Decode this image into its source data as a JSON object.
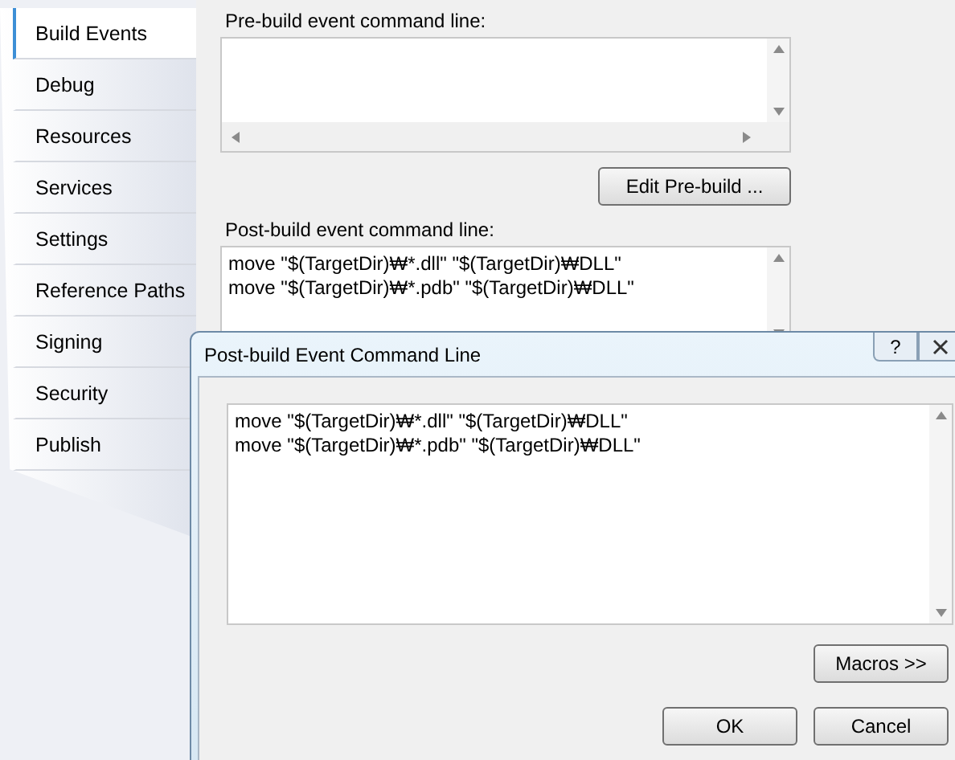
{
  "sidebar": {
    "items": [
      {
        "label": "Build Events",
        "selected": true
      },
      {
        "label": "Debug",
        "selected": false
      },
      {
        "label": "Resources",
        "selected": false
      },
      {
        "label": "Services",
        "selected": false
      },
      {
        "label": "Settings",
        "selected": false
      },
      {
        "label": "Reference Paths",
        "selected": false
      },
      {
        "label": "Signing",
        "selected": false
      },
      {
        "label": "Security",
        "selected": false
      },
      {
        "label": "Publish",
        "selected": false
      }
    ]
  },
  "pre_build": {
    "label": "Pre-build event command line:",
    "button": "Edit Pre-build ..."
  },
  "post_build": {
    "label": "Post-build event command line:",
    "lines": [
      "move \"$(TargetDir)₩*.dll\" \"$(TargetDir)₩DLL\"",
      "move \"$(TargetDir)₩*.pdb\" \"$(TargetDir)₩DLL\""
    ]
  },
  "dialog": {
    "title": "Post-build Event Command Line",
    "help": "?",
    "lines": [
      "move \"$(TargetDir)₩*.dll\" \"$(TargetDir)₩DLL\"",
      "move \"$(TargetDir)₩*.pdb\" \"$(TargetDir)₩DLL\""
    ],
    "macros_button": "Macros >>",
    "buttons": [
      "OK",
      "Cancel"
    ]
  }
}
